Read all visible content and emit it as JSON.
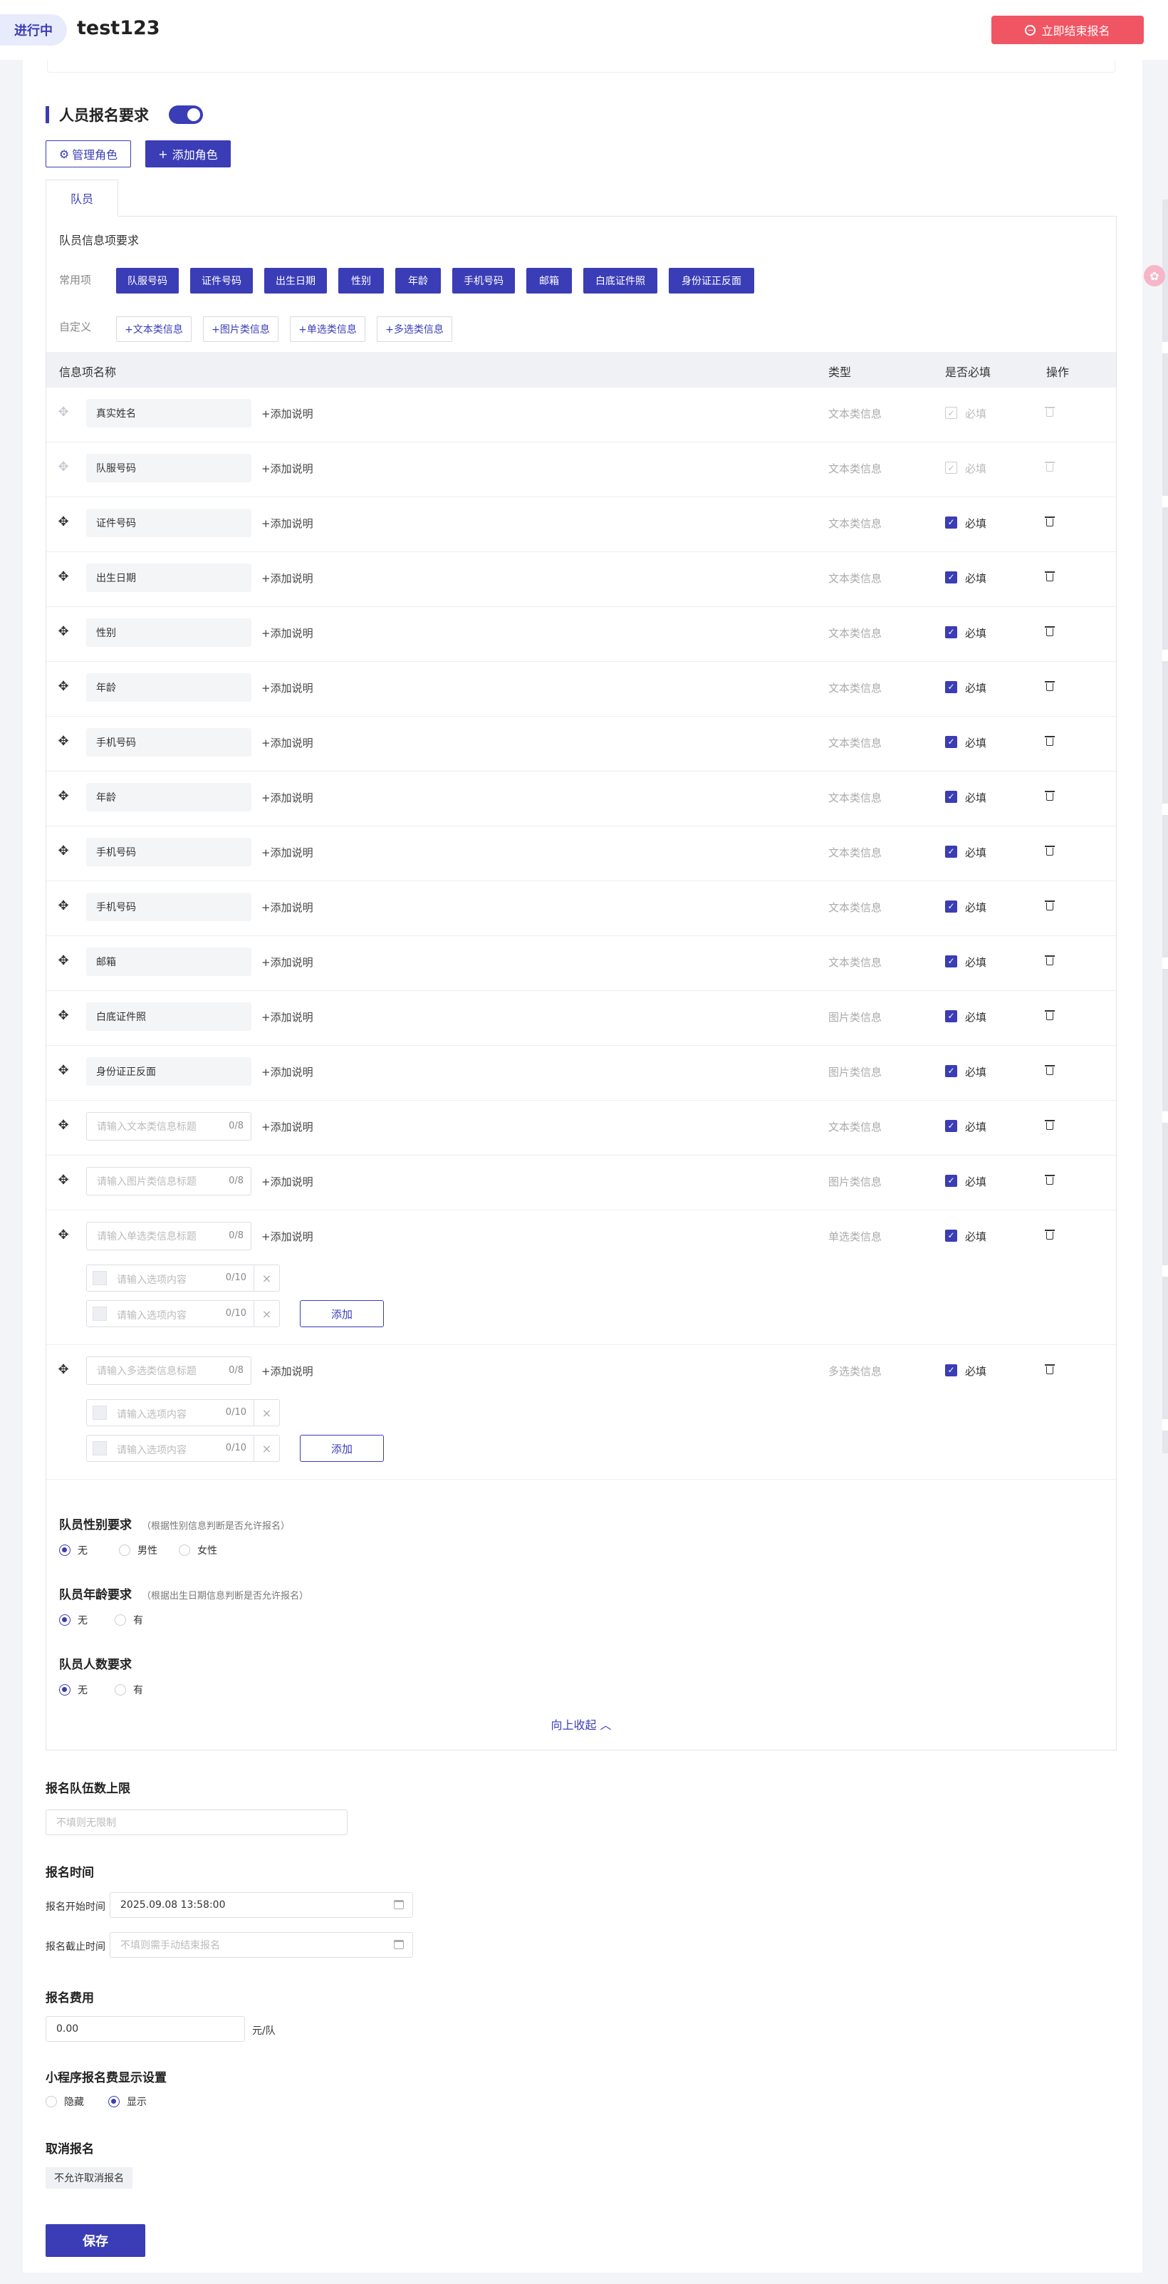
{
  "header": {
    "status": "进行中",
    "title": "test123",
    "end_button": "立即结束报名"
  },
  "section": {
    "title": "人员报名要求",
    "manage_roles": "管理角色",
    "add_role": "添加角色"
  },
  "tabs": [
    "队员"
  ],
  "panel": {
    "title": "队员信息项要求",
    "common_label": "常用项",
    "custom_label": "自定义",
    "common_tags": [
      "队服号码",
      "证件号码",
      "出生日期",
      "性别",
      "年龄",
      "手机号码",
      "邮箱",
      "白底证件照",
      "身份证正反面"
    ],
    "custom_tags": [
      "+文本类信息",
      "+图片类信息",
      "+单选类信息",
      "+多选类信息"
    ],
    "columns": {
      "name": "信息项名称",
      "type": "类型",
      "required": "是否必填",
      "action": "操作"
    },
    "add_desc": "+添加说明",
    "required_text": "必填",
    "rows": [
      {
        "name": "真实姓名",
        "type": "文本类信息",
        "disabled": true
      },
      {
        "name": "队服号码",
        "type": "文本类信息",
        "disabled": true
      },
      {
        "name": "证件号码",
        "type": "文本类信息"
      },
      {
        "name": "出生日期",
        "type": "文本类信息"
      },
      {
        "name": "性别",
        "type": "文本类信息"
      },
      {
        "name": "年龄",
        "type": "文本类信息"
      },
      {
        "name": "手机号码",
        "type": "文本类信息"
      },
      {
        "name": "年龄",
        "type": "文本类信息"
      },
      {
        "name": "手机号码",
        "type": "文本类信息"
      },
      {
        "name": "手机号码",
        "type": "文本类信息"
      },
      {
        "name": "邮箱",
        "type": "文本类信息"
      },
      {
        "name": "白底证件照",
        "type": "图片类信息"
      },
      {
        "name": "身份证正反面",
        "type": "图片类信息"
      },
      {
        "placeholder": "请输入文本类信息标题",
        "count": "0/8",
        "type": "文本类信息"
      },
      {
        "placeholder": "请输入图片类信息标题",
        "count": "0/8",
        "type": "图片类信息"
      },
      {
        "placeholder": "请输入单选类信息标题",
        "count": "0/8",
        "type": "单选类信息",
        "options": [
          {
            "placeholder": "请输入选项内容",
            "count": "0/10"
          },
          {
            "placeholder": "请输入选项内容",
            "count": "0/10"
          }
        ],
        "add_label": "添加"
      },
      {
        "placeholder": "请输入多选类信息标题",
        "count": "0/8",
        "type": "多选类信息",
        "options": [
          {
            "placeholder": "请输入选项内容",
            "count": "0/10"
          },
          {
            "placeholder": "请输入选项内容",
            "count": "0/10"
          }
        ],
        "add_label": "添加"
      }
    ],
    "gender": {
      "title": "队员性别要求",
      "hint": "（根据性别信息判断是否允许报名）",
      "options": [
        "无",
        "男性",
        "女性"
      ],
      "selected": "无"
    },
    "age": {
      "title": "队员年龄要求",
      "hint": "（根据出生日期信息判断是否允许报名）",
      "options": [
        "无",
        "有"
      ],
      "selected": "无"
    },
    "count": {
      "title": "队员人数要求",
      "options": [
        "无",
        "有"
      ],
      "selected": "无"
    },
    "collapse": "向上收起"
  },
  "team_limit": {
    "label": "报名队伍数上限",
    "placeholder": "不填则无限制"
  },
  "reg_time": {
    "label": "报名时间",
    "start_label": "报名开始时间",
    "start_value": "2025.09.08 13:58:00",
    "end_label": "报名截止时间",
    "end_placeholder": "不填则需手动结束报名"
  },
  "fee": {
    "label": "报名费用",
    "value": "0.00",
    "unit": "元/队"
  },
  "mini_display": {
    "label": "小程序报名费显示设置",
    "options": [
      "隐藏",
      "显示"
    ],
    "selected": "显示"
  },
  "cancel": {
    "label": "取消报名",
    "value": "不允许取消报名"
  },
  "save": "保存",
  "colors": {
    "primary": "#3a3db5",
    "danger": "#f05563"
  }
}
